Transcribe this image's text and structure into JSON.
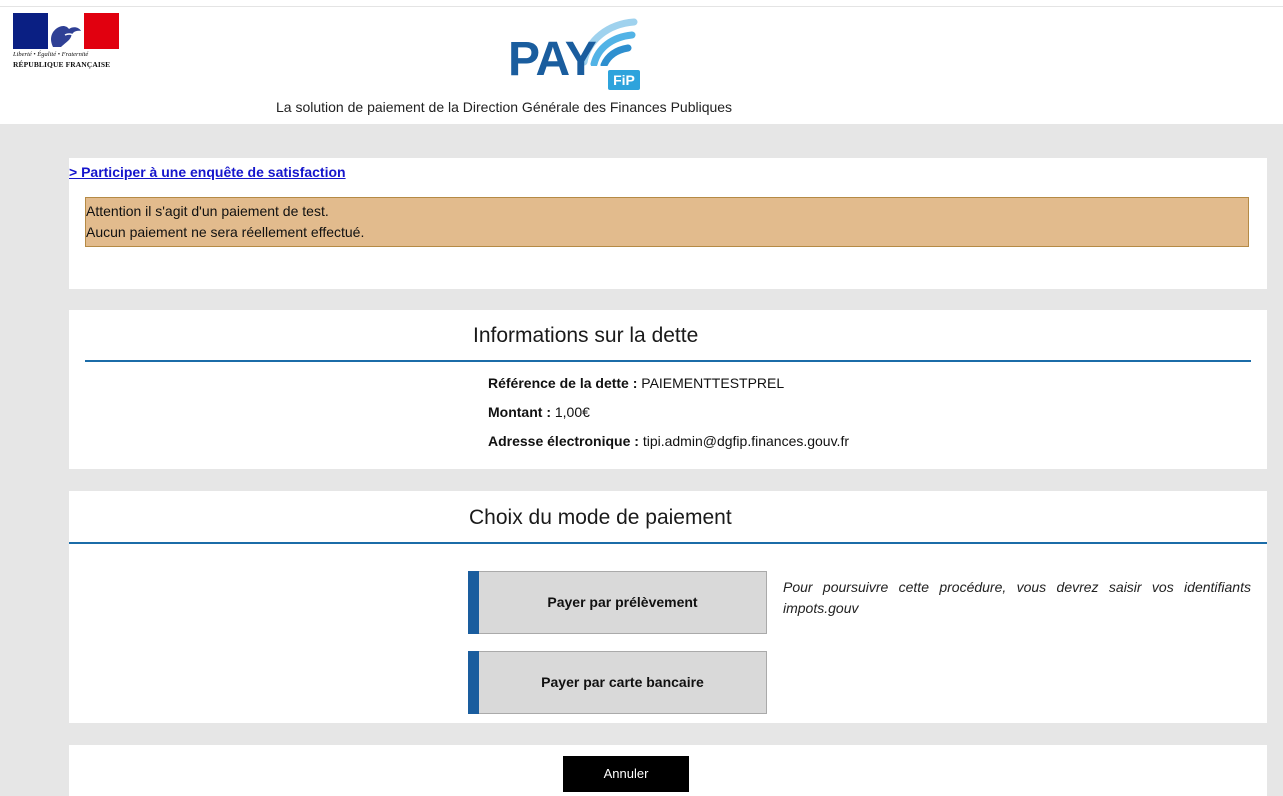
{
  "header": {
    "motto": "Liberté • Égalité • Fraternité",
    "republic": "RÉPUBLIQUE FRANÇAISE",
    "logo_pay": "PAY",
    "logo_fip": "FiP",
    "tagline": "La solution de paiement de la Direction Générale des Finances Publiques"
  },
  "survey_link": "> Participer à une enquête de satisfaction",
  "warning": {
    "line1": "Attention il s'agit d'un paiement de test.",
    "line2": "Aucun paiement ne sera réellement effectué."
  },
  "debt": {
    "title": "Informations sur la dette",
    "reference_label": "Référence de la dette :",
    "reference_value": "PAIEMENTTESTPREL",
    "amount_label": "Montant :",
    "amount_value": "1,00€",
    "email_label": "Adresse électronique :",
    "email_value": "tipi.admin@dgfip.finances.gouv.fr"
  },
  "payment": {
    "title": "Choix du mode de paiement",
    "debit_button": "Payer par prélèvement",
    "card_button": "Payer par carte bancaire",
    "note": "Pour poursuivre cette procédure, vous devrez saisir vos identifiants impots.gouv"
  },
  "cancel_button": "Annuler",
  "colors": {
    "brand_blue": "#1a5d9e",
    "accent_rule": "#1b6ca8",
    "warning_bg": "#e2bb8d",
    "link": "#1515cc",
    "background_gray": "#e6e6e6"
  }
}
